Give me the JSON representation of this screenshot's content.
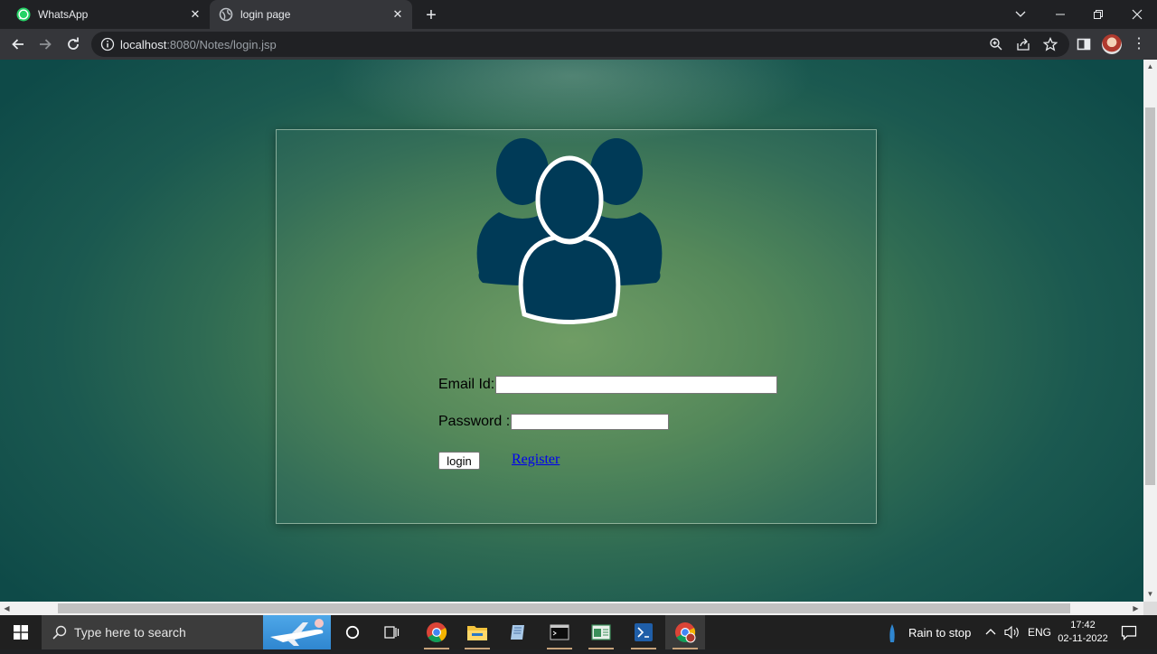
{
  "browser": {
    "tabs": [
      {
        "title": "WhatsApp",
        "icon": "whatsapp-icon",
        "active": false
      },
      {
        "title": "login page",
        "icon": "globe-icon",
        "active": true
      }
    ],
    "url_host": "localhost",
    "url_rest": ":8080/Notes/login.jsp"
  },
  "page": {
    "email_label": "Email Id:",
    "email_value": "",
    "password_label": "Password :",
    "password_value": "",
    "login_button": "login",
    "register_link": "Register",
    "icon": "users-group-icon"
  },
  "taskbar": {
    "search_placeholder": "Type here to search",
    "weather": "Rain to stop",
    "language": "ENG",
    "time": "17:42",
    "date": "02-11-2022"
  },
  "colors": {
    "accent_dark_blue": "#003a57",
    "link": "#0000ee"
  }
}
